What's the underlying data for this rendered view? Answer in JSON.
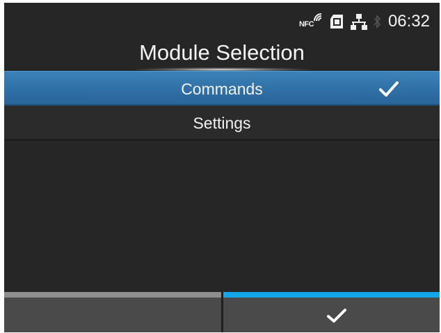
{
  "status_bar": {
    "nfc_label": "NFC",
    "time": "06:32",
    "icons": [
      "nfc-icon",
      "sd-card-icon",
      "network-icon",
      "bluetooth-icon"
    ]
  },
  "title": "Module Selection",
  "menu": {
    "items": [
      {
        "label": "Commands",
        "selected": true,
        "checked": true
      },
      {
        "label": "Settings",
        "selected": false,
        "checked": false
      }
    ]
  },
  "softkeys": {
    "left": {
      "icon": ""
    },
    "right": {
      "icon": "checkmark-icon"
    }
  },
  "colors": {
    "background": "#262626",
    "selection": "#3476ae",
    "softkey_active": "#13a6e9",
    "softkey_inactive": "#8e8e8e"
  }
}
